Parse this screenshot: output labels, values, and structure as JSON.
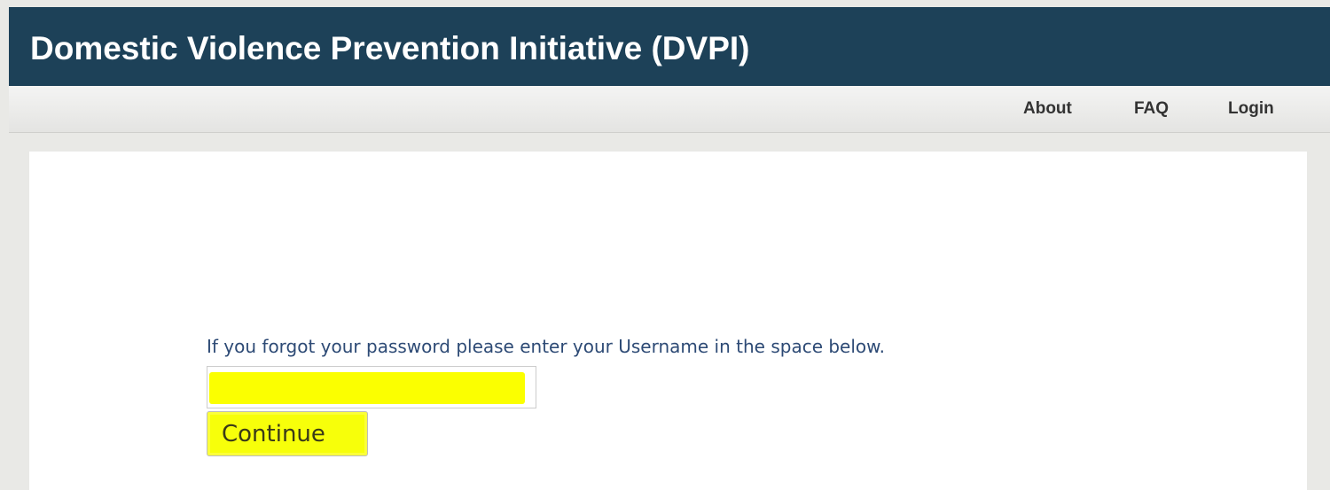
{
  "header": {
    "title": "Domestic Violence Prevention Initiative (DVPI)"
  },
  "nav": {
    "items": [
      {
        "label": "About"
      },
      {
        "label": "FAQ"
      },
      {
        "label": "Login"
      }
    ]
  },
  "form": {
    "instructions": "If you forgot your password please enter your Username in the space below.",
    "username_value": "",
    "username_placeholder": "",
    "continue_label": "Continue"
  },
  "colors": {
    "header_bg": "#1d4158",
    "highlight": "#fbff00",
    "instruction_text": "#2d4a75"
  }
}
